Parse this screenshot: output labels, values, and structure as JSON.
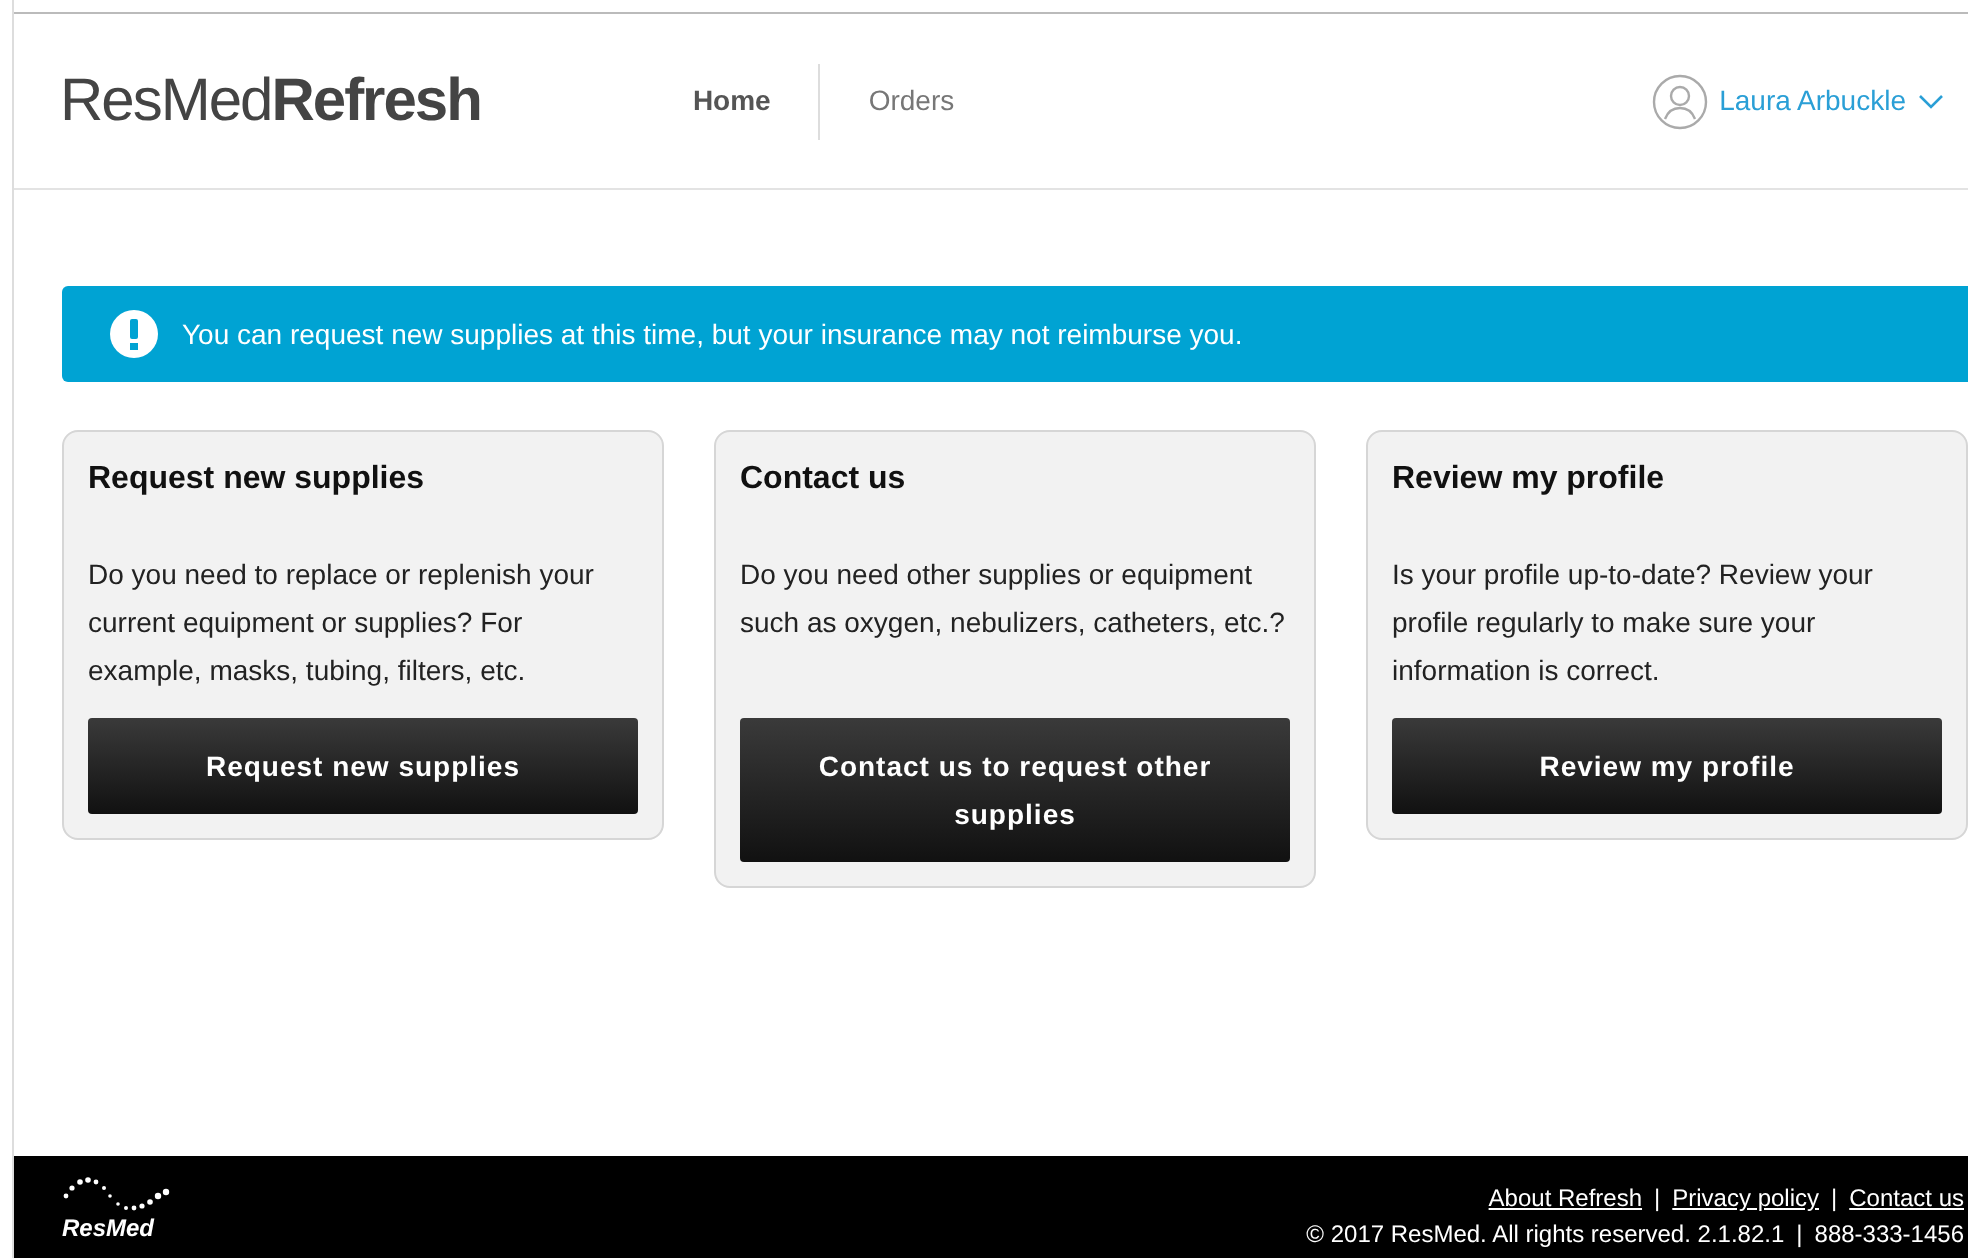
{
  "header": {
    "logo": "ResMed**Refresh**",
    "nav": [
      {
        "label": "Home",
        "selected": true
      },
      {
        "label": "Orders",
        "selected": false
      }
    ],
    "user": {
      "name": "Laura Arbuckle"
    }
  },
  "alert": {
    "text": "You can request new supplies at this time, but your insurance may not reimburse you."
  },
  "cards": [
    {
      "title": "Request new supplies",
      "text": "Do you need to replace or replenish your current equipment or supplies? For example, masks, tubing, filters, etc.",
      "button": "Request new supplies"
    },
    {
      "title": "Contact us",
      "text": "Do you need other supplies or equipment such as oxygen, nebulizers, catheters, etc.?",
      "button": "Contact us to request other supplies"
    },
    {
      "title": "Review my profile",
      "text": "Is your profile up-to-date? Review your profile regularly to make sure your information is correct.",
      "button": "Review my profile"
    }
  ],
  "footer": {
    "logo": "ResMed",
    "links": [
      "About Refresh",
      "Privacy policy",
      "Contact us"
    ],
    "separator": "|",
    "copyright": "© 2017 ResMed. All rights reserved. 2.1.82.1",
    "phone": "888-333-1456"
  }
}
